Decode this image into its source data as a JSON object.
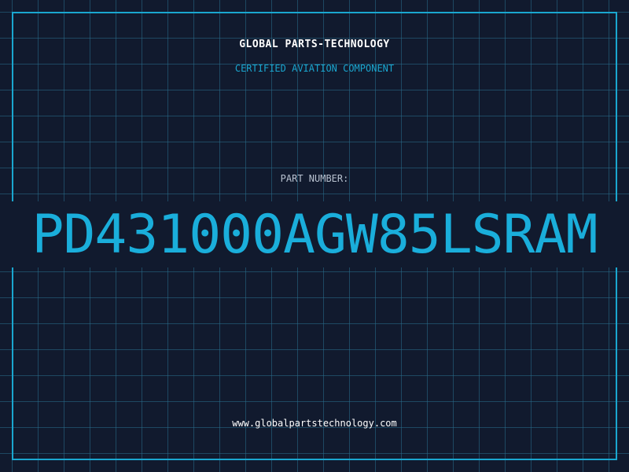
{
  "header": {
    "company": "GLOBAL PARTS-TECHNOLOGY",
    "subtitle": "CERTIFIED AVIATION COMPONENT"
  },
  "part": {
    "label": "PART NUMBER:",
    "number": "PD431000AGW85LSRAM"
  },
  "footer": {
    "url": "www.globalpartstechnology.com"
  },
  "colors": {
    "background": "#111a2e",
    "accent": "#1aa6cf",
    "grid": "#286e8c"
  }
}
